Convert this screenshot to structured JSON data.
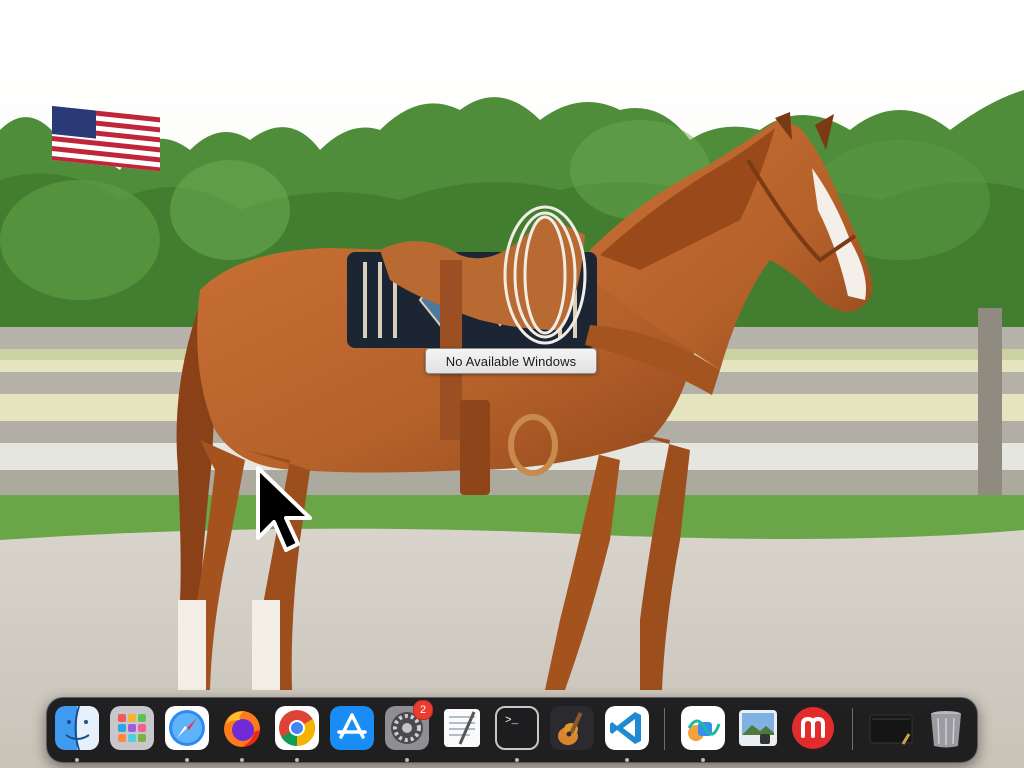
{
  "desktop": {
    "tooltip_text": "No Available Windows"
  },
  "dock": {
    "items": [
      {
        "name": "Finder",
        "icon": "finder-icon",
        "running": true
      },
      {
        "name": "Launchpad",
        "icon": "launchpad-icon",
        "running": false
      },
      {
        "name": "Safari",
        "icon": "safari-icon",
        "running": true
      },
      {
        "name": "Firefox",
        "icon": "firefox-icon",
        "running": true
      },
      {
        "name": "Google Chrome",
        "icon": "chrome-icon",
        "running": true
      },
      {
        "name": "App Store",
        "icon": "app-store-icon",
        "running": false
      },
      {
        "name": "System Settings",
        "icon": "system-settings-icon",
        "running": true,
        "badge": "2"
      },
      {
        "name": "TextEdit",
        "icon": "textedit-icon",
        "running": false
      },
      {
        "name": "Terminal",
        "icon": "terminal-icon",
        "running": true,
        "prompt": ">_"
      },
      {
        "name": "GarageBand",
        "icon": "garageband-icon",
        "running": false
      },
      {
        "name": "Visual Studio Code",
        "icon": "vscode-icon",
        "running": true
      },
      {
        "name": "Freeform",
        "icon": "freeform-icon",
        "running": true
      },
      {
        "name": "Preview",
        "icon": "preview-icon",
        "running": false
      },
      {
        "name": "Mastodon",
        "icon": "mastodon-icon",
        "running": false
      },
      {
        "name": "Downloads",
        "icon": "downloads-stack-icon",
        "running": false
      },
      {
        "name": "Trash",
        "icon": "trash-icon",
        "running": false
      }
    ]
  },
  "colors": {
    "dock_background": "#121214",
    "badge_red": "#ee3b2f",
    "horse_chestnut": "#b8652c"
  }
}
